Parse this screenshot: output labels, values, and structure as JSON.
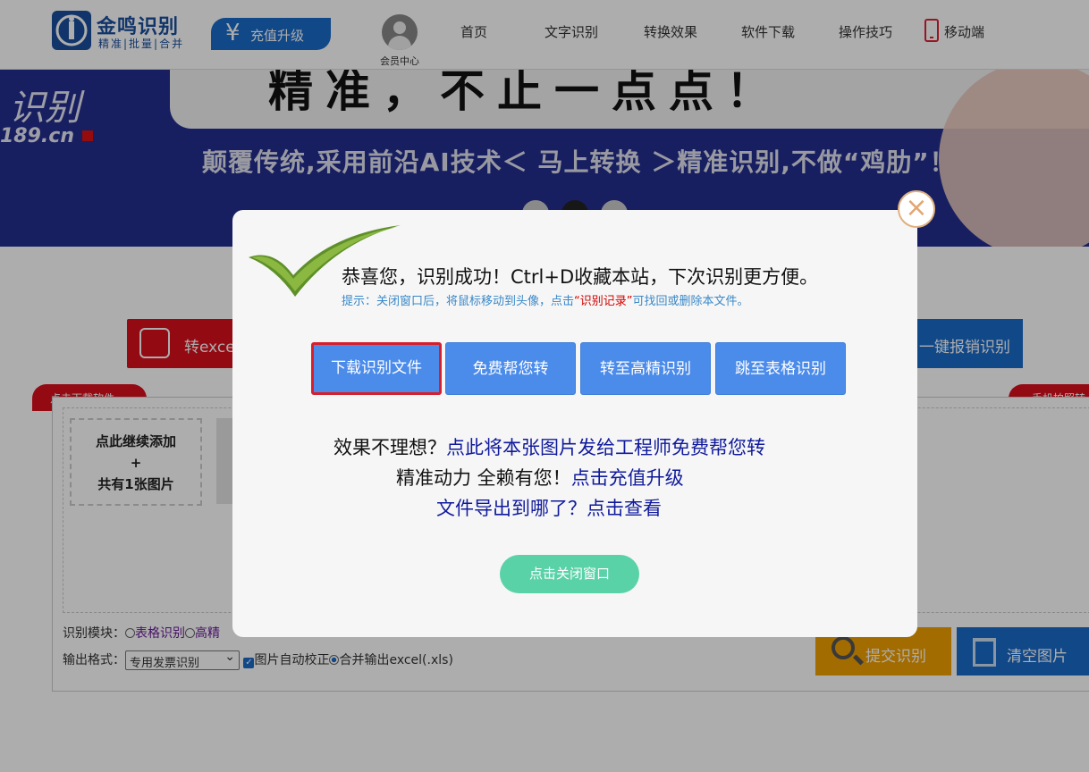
{
  "header": {
    "logo_name": "金鸣识别",
    "logo_slogan": "精准|批量|合并",
    "recharge_symbol": "¥",
    "recharge_label": "充值升级",
    "member_label": "会员中心",
    "nav": [
      "首页",
      "文字识别",
      "转换效果",
      "软件下载",
      "操作技巧"
    ],
    "mobile_label": "移动端"
  },
  "banner": {
    "big_text": "精准，不止一点点！",
    "side_text": "识别",
    "side_url": "189.cn",
    "tagline": "颠覆传统,采用前沿AI技术＜ 马上转换 ＞精准识别,不做“鸡肋”！"
  },
  "main": {
    "func_excel_label": "转exce",
    "func_report_label": "一键报销识别",
    "tab_download": "点击下载软件",
    "tab_photo": "手机拍照转",
    "add_box_line1": "点此继续添加",
    "add_box_line2": "+",
    "add_box_line3": "共有1张图片",
    "module_label": "识别模块：",
    "module_table": "表格识别",
    "module_high": "高精",
    "output_label": "输出格式：",
    "output_select": "专用发票识别",
    "auto_correct": "图片自动校正",
    "merge_output": "合并输出excel(.xls)",
    "submit_label": "提交识别",
    "clear_label": "清空图片"
  },
  "modal": {
    "close_symbol": "×",
    "title": "恭喜您，识别成功！Ctrl+D收藏本站，下次识别更方便。",
    "tip_prefix": "提示：关闭窗口后，将鼠标移动到头像，点击",
    "tip_highlight": "“识别记录”",
    "tip_suffix": "可找回或删除本文件。",
    "buttons": [
      "下载识别文件",
      "免费帮您转",
      "转至高精识别",
      "跳至表格识别"
    ],
    "line1_dark": "效果不理想？",
    "line1_link": "点此将本张图片发给工程师免费帮您转",
    "line2_dark": "精准动力 全赖有您！",
    "line2_link": "点击充值升级",
    "line3_link": "文件导出到哪了？点击查看",
    "close_button": "点击关闭窗口"
  },
  "colors": {
    "brand_blue": "#1a6ac9",
    "brand_red": "#d90f1c",
    "modal_button": "#4b8bea",
    "close_green": "#5ad2a8"
  }
}
